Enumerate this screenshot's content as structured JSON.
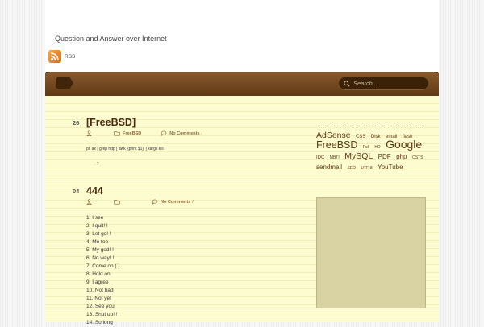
{
  "site": {
    "tagline": "Question and Answer over Internet",
    "rss_label": "RSS"
  },
  "search": {
    "placeholder": "Search..."
  },
  "posts": [
    {
      "date": "26",
      "title": "[FreeBSD]",
      "category": "FreeBSD",
      "comments": "No Comments",
      "sep": "/",
      "body": "ps ax | grep http | awk '{print $1}' | xargs kill",
      "extra": ". ?"
    },
    {
      "date": "04",
      "title": "444",
      "comments": "No Comments",
      "sep": "/",
      "items": [
        "1. I see",
        "2. I quit!   !",
        "3. Let go!   !",
        "4. Me too",
        "5. My god!   !",
        "6. No way!   !",
        "7. Come on   ( )",
        "8. Hold on",
        "9. I agree",
        "10. Not bad",
        "11. Not yet",
        "12. See you",
        "13. Shut up!   !",
        "14. So long"
      ]
    }
  ],
  "tags": [
    {
      "label": "AdSense",
      "size": "t1"
    },
    {
      "label": "CSS",
      "size": "t4"
    },
    {
      "label": "Disk",
      "size": "t4"
    },
    {
      "label": "email",
      "size": "t4"
    },
    {
      "label": "flash",
      "size": "t4"
    },
    {
      "label": "FreeBSD",
      "size": "t2"
    },
    {
      "label": "Full",
      "size": "t5"
    },
    {
      "label": "HD",
      "size": "t5"
    },
    {
      "label": "Google",
      "size": "t3"
    },
    {
      "label": "IDC",
      "size": "t4"
    },
    {
      "label": "MBTI",
      "size": "t5"
    },
    {
      "label": "MySQL",
      "size": "t1"
    },
    {
      "label": "PDF",
      "size": "t6"
    },
    {
      "label": "php",
      "size": "t6"
    },
    {
      "label": "QSTS",
      "size": "t5"
    },
    {
      "label": "sendmail",
      "size": "t6"
    },
    {
      "label": "SEO",
      "size": "t5"
    },
    {
      "label": "UTF-8",
      "size": "t5"
    },
    {
      "label": "YouTube",
      "size": "t6"
    }
  ],
  "colors": {
    "nav_dark": "#5e3915",
    "nav_light": "#8a5b2e",
    "paper": "#fdfbd0",
    "title": "#4a2a0e",
    "rss": "#e06b10"
  }
}
